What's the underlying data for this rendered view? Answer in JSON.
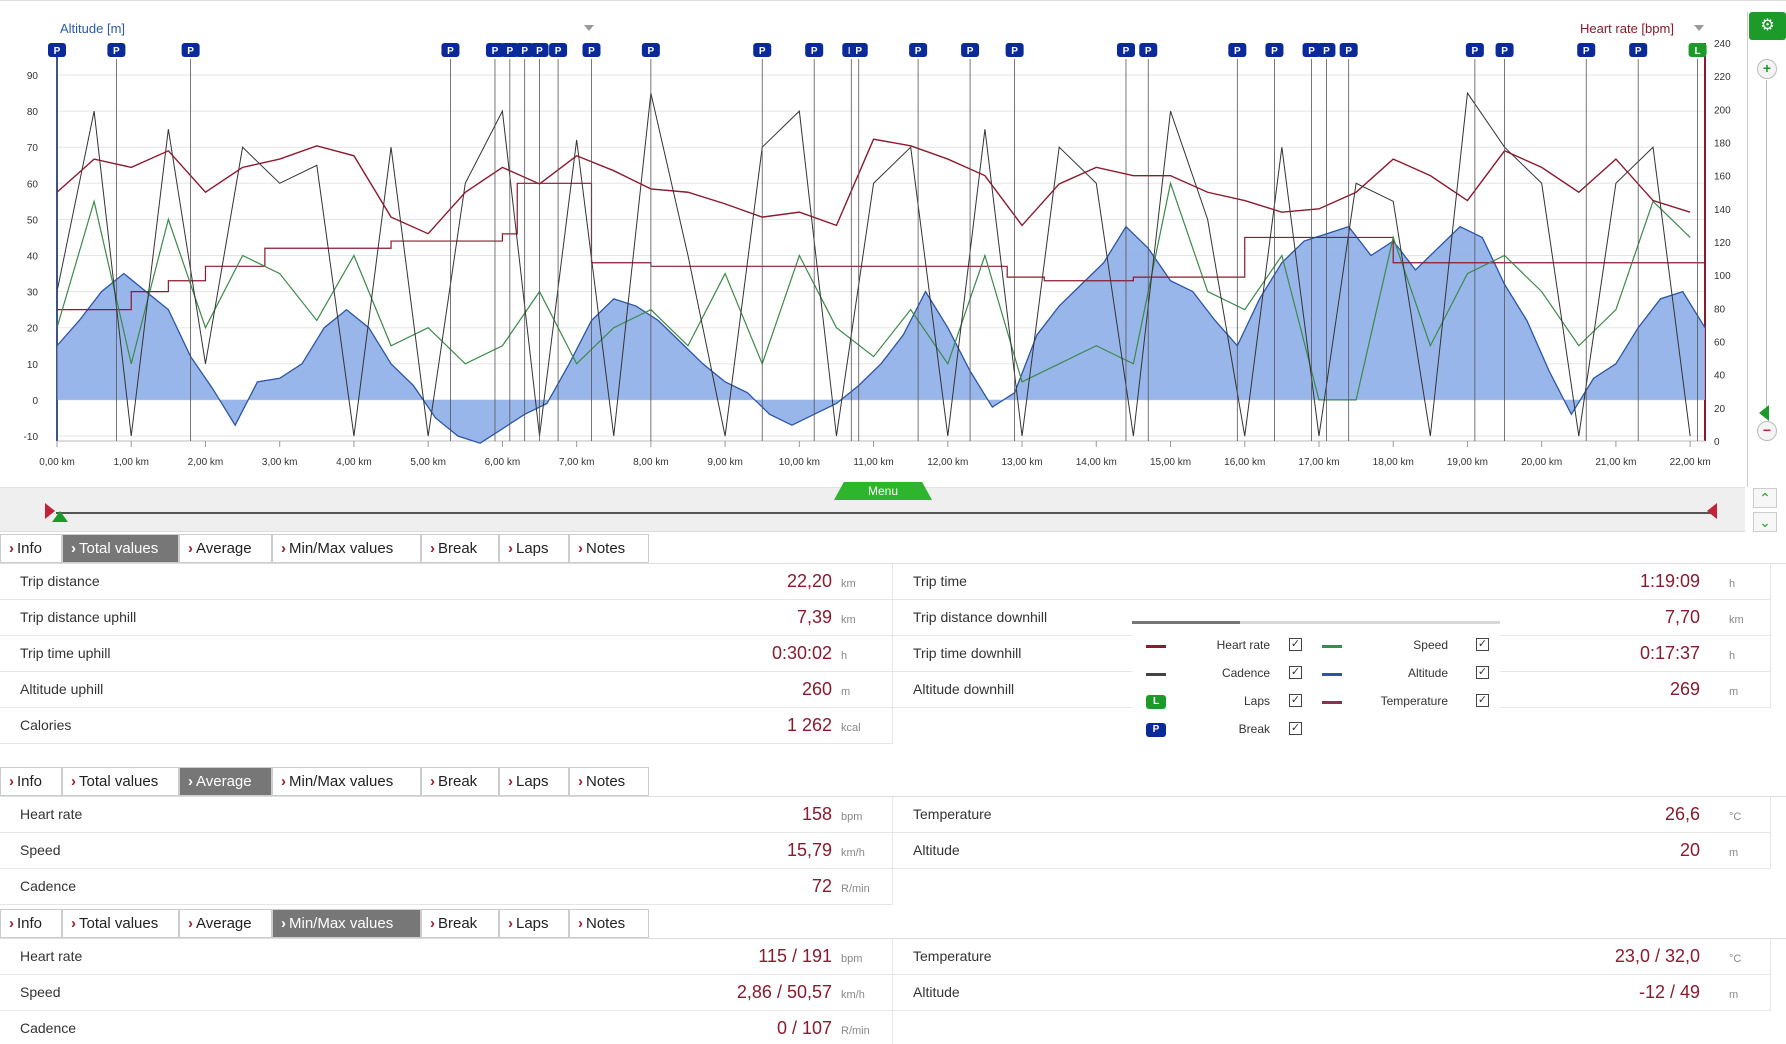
{
  "chart": {
    "left_axis_title": "Altitude [m]",
    "right_axis_title": "Heart rate [bpm]",
    "left_ticks": [
      "90",
      "80",
      "70",
      "60",
      "50",
      "40",
      "30",
      "20",
      "10",
      "0",
      "-10"
    ],
    "right_ticks": [
      "240",
      "220",
      "200",
      "180",
      "160",
      "140",
      "120",
      "100",
      "80",
      "60",
      "40",
      "20",
      "0"
    ],
    "x_ticks": [
      "0,00 km",
      "1,00 km",
      "2,00 km",
      "3,00 km",
      "4,00 km",
      "5,00 km",
      "6,00 km",
      "7,00 km",
      "8,00 km",
      "9,00 km",
      "10,00 km",
      "11,00 km",
      "12,00 km",
      "13,00 km",
      "14,00 km",
      "15,00 km",
      "16,00 km",
      "17,00 km",
      "18,00 km",
      "19,00 km",
      "20,00 km",
      "21,00 km",
      "22,00 km"
    ],
    "break_marker": "P",
    "lap_marker": "L",
    "colors": {
      "altitude_fill": "#8eaee8",
      "altitude_line": "#2a55a5",
      "heart_rate": "#8b1a2e",
      "cadence": "#333333",
      "speed": "#3a8a4a",
      "temperature": "#8b1a2e",
      "break": "#0a2a9a",
      "lap": "#1c9b2a"
    }
  },
  "chart_data": {
    "type": "line",
    "title": "",
    "xlabel": "",
    "ylabel": "Altitude [m]",
    "y2label": "Heart rate [bpm]",
    "xlim": [
      0,
      22.2
    ],
    "ylim": [
      -10,
      100
    ],
    "y2lim": [
      0,
      240
    ],
    "break_positions_km": [
      0.0,
      0.8,
      1.8,
      5.3,
      5.9,
      6.1,
      6.3,
      6.5,
      6.75,
      7.2,
      8.0,
      9.5,
      10.2,
      10.7,
      10.8,
      11.6,
      12.3,
      12.9,
      14.4,
      14.7,
      15.9,
      16.4,
      16.9,
      17.1,
      17.4,
      19.1,
      19.5,
      20.6,
      21.3
    ],
    "lap_positions_km": [
      22.1
    ],
    "series": [
      {
        "name": "Altitude",
        "axis": "left",
        "x": [
          0,
          0.3,
          0.6,
          0.9,
          1.2,
          1.5,
          1.8,
          2.1,
          2.4,
          2.7,
          3.0,
          3.3,
          3.6,
          3.9,
          4.2,
          4.5,
          4.8,
          5.1,
          5.4,
          5.7,
          6.0,
          6.3,
          6.6,
          6.9,
          7.2,
          7.5,
          7.8,
          8.1,
          8.4,
          8.7,
          9.0,
          9.3,
          9.6,
          9.9,
          10.2,
          10.5,
          10.8,
          11.1,
          11.4,
          11.7,
          12.0,
          12.3,
          12.6,
          12.9,
          13.2,
          13.5,
          13.8,
          14.1,
          14.4,
          14.7,
          15.0,
          15.3,
          15.6,
          15.9,
          16.2,
          16.5,
          16.8,
          17.1,
          17.4,
          17.7,
          18.0,
          18.3,
          18.6,
          18.9,
          19.2,
          19.5,
          19.8,
          20.1,
          20.4,
          20.7,
          21.0,
          21.3,
          21.6,
          21.9,
          22.2
        ],
        "y": [
          15,
          22,
          30,
          35,
          30,
          25,
          12,
          3,
          -7,
          5,
          6,
          10,
          20,
          25,
          20,
          10,
          4,
          -5,
          -10,
          -12,
          -8,
          -4,
          -1,
          10,
          22,
          28,
          26,
          22,
          16,
          10,
          5,
          2,
          -4,
          -7,
          -4,
          -1,
          4,
          10,
          18,
          30,
          20,
          8,
          -2,
          2,
          18,
          26,
          32,
          38,
          48,
          42,
          33,
          30,
          22,
          15,
          28,
          38,
          44,
          46,
          48,
          40,
          44,
          36,
          42,
          48,
          45,
          32,
          22,
          8,
          -4,
          6,
          10,
          20,
          28,
          30,
          20
        ]
      },
      {
        "name": "Heart rate",
        "axis": "right",
        "x": [
          0,
          0.5,
          1,
          1.5,
          2,
          2.5,
          3,
          3.5,
          4,
          4.5,
          5,
          5.5,
          6,
          6.5,
          7,
          7.5,
          8,
          8.5,
          9,
          9.5,
          10,
          10.5,
          11,
          11.5,
          12,
          12.5,
          13,
          13.5,
          14,
          14.5,
          15,
          15.5,
          16,
          16.5,
          17,
          17.5,
          18,
          18.5,
          19,
          19.5,
          20,
          20.5,
          21,
          21.5,
          22
        ],
        "y": [
          150,
          170,
          165,
          175,
          150,
          165,
          170,
          178,
          172,
          135,
          125,
          150,
          165,
          155,
          172,
          163,
          152,
          150,
          143,
          135,
          138,
          130,
          182,
          178,
          170,
          160,
          130,
          155,
          165,
          160,
          160,
          150,
          145,
          138,
          140,
          150,
          170,
          160,
          145,
          175,
          165,
          150,
          170,
          145,
          138
        ]
      },
      {
        "name": "Cadence",
        "axis": "left",
        "x": [
          0,
          0.5,
          1,
          1.5,
          2,
          2.5,
          3,
          3.5,
          4,
          4.5,
          5,
          5.5,
          6,
          6.5,
          7,
          7.5,
          8,
          8.5,
          9,
          9.5,
          10,
          10.5,
          11,
          11.5,
          12,
          12.5,
          13,
          13.5,
          14,
          14.5,
          15,
          15.5,
          16,
          16.5,
          17,
          17.5,
          18,
          18.5,
          19,
          19.5,
          20,
          20.5,
          21,
          21.5,
          22
        ],
        "y": [
          30,
          80,
          -10,
          75,
          10,
          70,
          60,
          65,
          -10,
          70,
          -10,
          60,
          80,
          -10,
          72,
          -10,
          85,
          40,
          -10,
          70,
          80,
          -10,
          60,
          70,
          -10,
          75,
          -10,
          70,
          60,
          -10,
          80,
          50,
          -10,
          70,
          -10,
          60,
          55,
          -10,
          85,
          70,
          60,
          -10,
          60,
          70,
          -10
        ]
      },
      {
        "name": "Speed",
        "axis": "left",
        "x": [
          0,
          0.5,
          1,
          1.5,
          2,
          2.5,
          3,
          3.5,
          4,
          4.5,
          5,
          5.5,
          6,
          6.5,
          7,
          7.5,
          8,
          8.5,
          9,
          9.5,
          10,
          10.5,
          11,
          11.5,
          12,
          12.5,
          13,
          13.5,
          14,
          14.5,
          15,
          15.5,
          16,
          16.5,
          17,
          17.5,
          18,
          18.5,
          19,
          19.5,
          20,
          20.5,
          21,
          21.5,
          22
        ],
        "y": [
          20,
          55,
          10,
          50,
          20,
          40,
          35,
          22,
          40,
          15,
          20,
          10,
          15,
          30,
          10,
          20,
          25,
          15,
          35,
          10,
          40,
          20,
          12,
          25,
          10,
          40,
          5,
          10,
          15,
          10,
          60,
          30,
          25,
          40,
          0,
          0,
          45,
          15,
          35,
          40,
          30,
          15,
          25,
          55,
          45
        ]
      },
      {
        "name": "Temperature",
        "axis": "left",
        "x": [
          0,
          1,
          1.5,
          2,
          2.8,
          4.5,
          6,
          6.2,
          7.2,
          8,
          9,
          11,
          12.8,
          13.3,
          14.5,
          16,
          18,
          20,
          21,
          22.2
        ],
        "y": [
          25,
          30,
          33,
          37,
          42,
          44,
          46,
          60,
          38,
          37,
          37,
          37,
          34,
          33,
          34,
          45,
          38,
          38,
          38,
          34
        ]
      }
    ]
  },
  "legend": {
    "items": [
      {
        "name": "Heart rate",
        "color": "#8b1a2e"
      },
      {
        "name": "Speed",
        "color": "#3a8a4a"
      },
      {
        "name": "Cadence",
        "color": "#444444"
      },
      {
        "name": "Altitude",
        "color": "#2a55a5"
      },
      {
        "name": "Laps",
        "badge": "L"
      },
      {
        "name": "Temperature",
        "color": "#8b3050"
      },
      {
        "name": "Break",
        "badge": "P"
      }
    ],
    "checkmark": "✓"
  },
  "menu_label": "Menu",
  "tabs": [
    "Info",
    "Total values",
    "Average",
    "Min/Max values",
    "Break",
    "Laps",
    "Notes"
  ],
  "total": {
    "left": [
      {
        "label": "Trip distance",
        "value": "22,20",
        "unit": "km"
      },
      {
        "label": "Trip distance uphill",
        "value": "7,39",
        "unit": "km"
      },
      {
        "label": "Trip time uphill",
        "value": "0:30:02",
        "unit": "h"
      },
      {
        "label": "Altitude uphill",
        "value": "260",
        "unit": "m"
      },
      {
        "label": "Calories",
        "value": "1 262",
        "unit": "kcal"
      }
    ],
    "right": [
      {
        "label": "Trip time",
        "value": "1:19:09",
        "unit": "h"
      },
      {
        "label": "Trip distance downhill",
        "value": "7,70",
        "unit": "km"
      },
      {
        "label": "Trip time downhill",
        "value": "0:17:37",
        "unit": "h"
      },
      {
        "label": "Altitude downhill",
        "value": "269",
        "unit": "m"
      }
    ]
  },
  "average": {
    "left": [
      {
        "label": "Heart rate",
        "value": "158",
        "unit": "bpm"
      },
      {
        "label": "Speed",
        "value": "15,79",
        "unit": "km/h"
      },
      {
        "label": "Cadence",
        "value": "72",
        "unit": "R/min"
      }
    ],
    "right": [
      {
        "label": "Temperature",
        "value": "26,6",
        "unit": "°C"
      },
      {
        "label": "Altitude",
        "value": "20",
        "unit": "m"
      }
    ]
  },
  "minmax": {
    "left": [
      {
        "label": "Heart rate",
        "value": "115 / 191",
        "unit": "bpm"
      },
      {
        "label": "Speed",
        "value": "2,86 / 50,57",
        "unit": "km/h"
      },
      {
        "label": "Cadence",
        "value": "0 / 107",
        "unit": "R/min"
      }
    ],
    "right": [
      {
        "label": "Temperature",
        "value": "23,0 / 32,0",
        "unit": "°C"
      },
      {
        "label": "Altitude",
        "value": "-12 / 49",
        "unit": "m"
      }
    ]
  },
  "sidebar": {
    "settings_icon": "⚙",
    "zoom_in": "+",
    "zoom_out": "−",
    "scroll_up": "⌃",
    "scroll_down": "⌄"
  }
}
